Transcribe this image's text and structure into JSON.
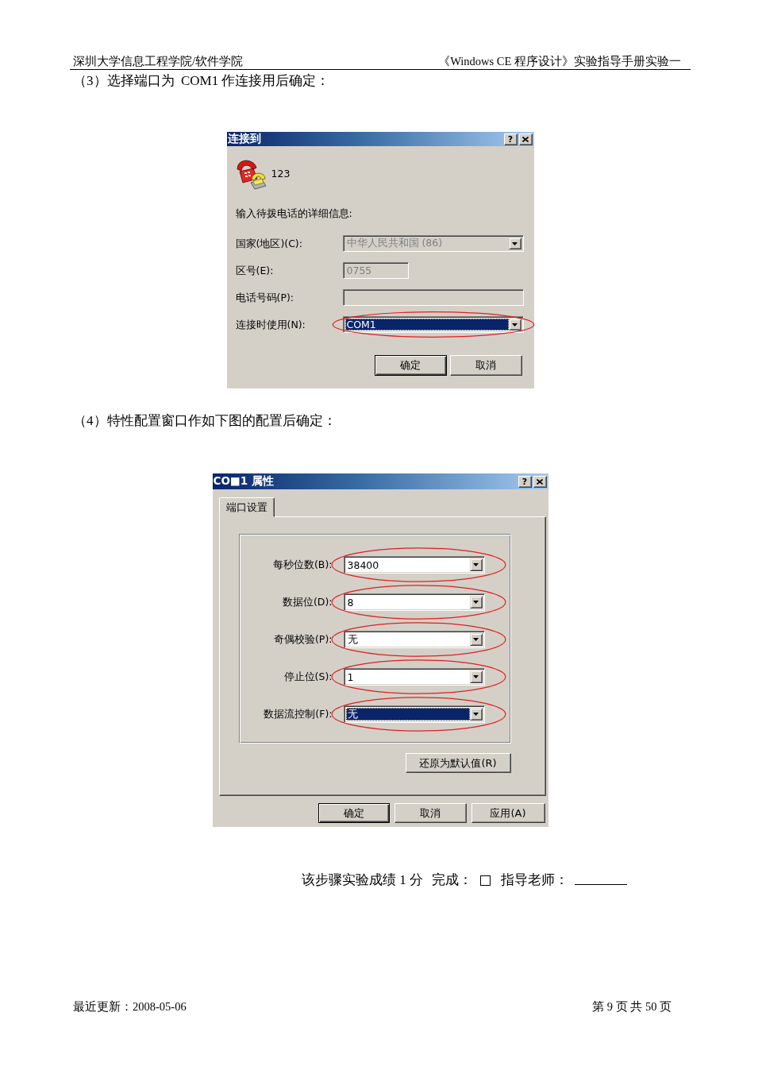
{
  "header": {
    "left": "深圳大学信息工程学院/软件学院",
    "right": "《Windows CE 程序设计》实验指导手册实验一"
  },
  "step_3": "（3）选择端口为  COM1 作连接用后确定：",
  "dialog_1": {
    "title": "连接到",
    "help_button": "?",
    "connection_name": "123",
    "prompt": "输入待拨电话的详细信息:",
    "fields": [
      {
        "kind": "dropdown",
        "label": "国家(地区)(C):",
        "value": "中华人民共和国 (86)",
        "disabled": true,
        "focused": false,
        "circled": false
      },
      {
        "kind": "short_input",
        "label": "区号(E):",
        "value": "0755",
        "disabled": true,
        "circled": false
      },
      {
        "kind": "input",
        "label": "电话号码(P):",
        "disabled": true,
        "circled": false
      },
      {
        "kind": "dropdown",
        "label": "连接时使用(N):",
        "value": "COM1",
        "disabled": false,
        "focused": true,
        "circled": true
      }
    ],
    "buttons": [
      {
        "label": "确定",
        "default": true
      },
      {
        "label": "取消",
        "default": false
      }
    ]
  },
  "step_4": "（4）特性配置窗口作如下图的配置后确定：",
  "dialog_2": {
    "title": "CO■1 属性",
    "help_button": "?",
    "tabs": [
      {
        "label": "端口设置",
        "selected": true
      }
    ],
    "fields": [
      {
        "kind": "dropdown",
        "label": "每秒位数(B):",
        "value": "38400",
        "disabled": false,
        "focused": false,
        "circled": true
      },
      {
        "kind": "dropdown",
        "label": "数据位(D):",
        "value": "8",
        "disabled": false,
        "focused": false,
        "circled": true
      },
      {
        "kind": "dropdown",
        "label": "奇偶校验(P):",
        "value": "无",
        "disabled": false,
        "focused": false,
        "circled": true
      },
      {
        "kind": "dropdown",
        "label": "停止位(S):",
        "value": "1",
        "disabled": false,
        "focused": false,
        "circled": true
      },
      {
        "kind": "dropdown",
        "label": "数据流控制(F):",
        "value": "无",
        "disabled": false,
        "focused": true,
        "circled": true
      }
    ],
    "restore_button": "还原为默认值(R)",
    "buttons": [
      {
        "label": "确定",
        "default": true
      },
      {
        "label": "取消",
        "default": false
      },
      {
        "label": "应用(A)",
        "default": false
      }
    ]
  },
  "score_line": {
    "score": "该步骤实验成绩 1 分",
    "completion_label": "完成：",
    "completion_checkbox": {
      "checked": false
    },
    "teacher_label": "指导老师："
  },
  "footer": {
    "last_updated": "最近更新：2008-05-06",
    "page": "第 9 页 共 50 页"
  }
}
